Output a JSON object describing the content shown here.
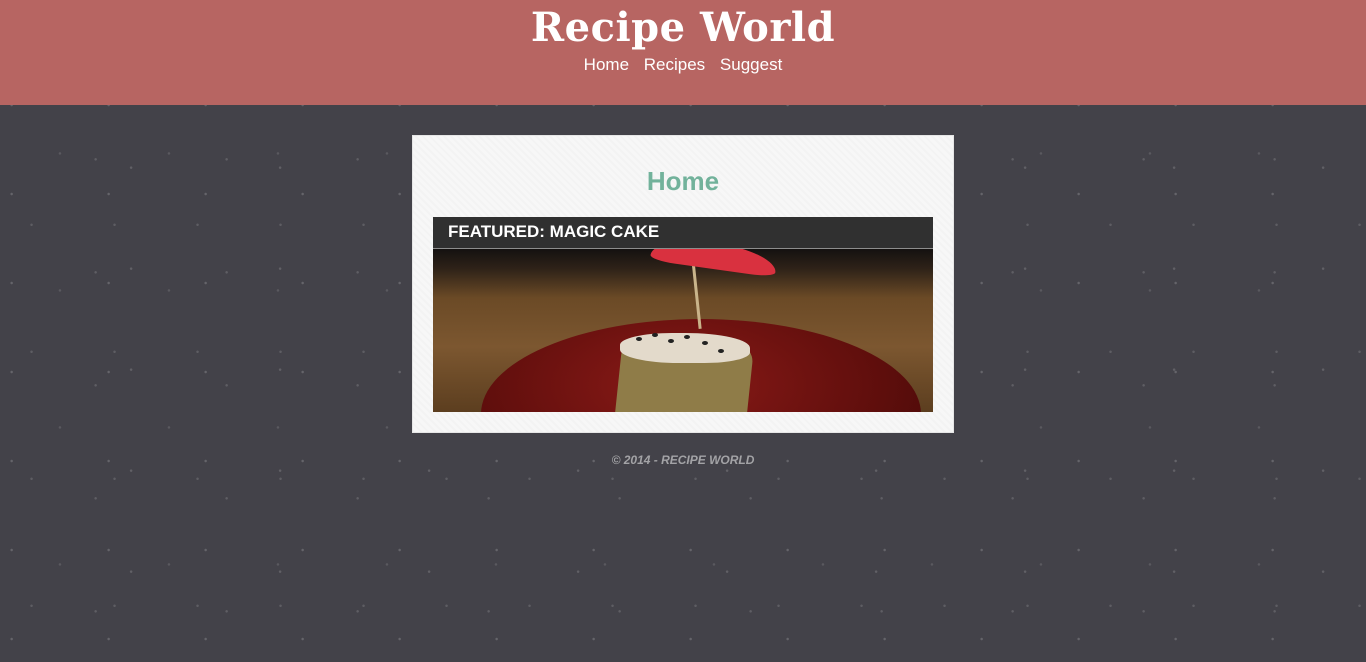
{
  "header": {
    "title": "Recipe World",
    "nav": [
      {
        "label": "Home"
      },
      {
        "label": "Recipes"
      },
      {
        "label": "Suggest"
      }
    ]
  },
  "main": {
    "page_title": "Home",
    "featured": {
      "label": "Featured: Magic Cake"
    }
  },
  "footer": {
    "text": "© 2014 - RECIPE WORLD"
  },
  "colors": {
    "header_bg": "#b76562",
    "page_bg": "#434249",
    "accent_title": "#72b29b",
    "featured_bar": "#303030"
  }
}
